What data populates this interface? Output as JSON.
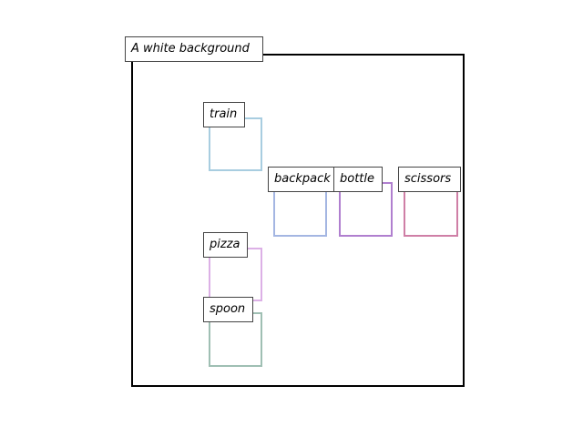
{
  "caption": "A white background",
  "objects": [
    {
      "id": "train",
      "label": "train",
      "color": "#a8cde0"
    },
    {
      "id": "backpack",
      "label": "backpack",
      "color": "#a4b6e2"
    },
    {
      "id": "bottle",
      "label": "bottle",
      "color": "#b07fcf"
    },
    {
      "id": "scissors",
      "label": "scissors",
      "color": "#cf7fa6"
    },
    {
      "id": "pizza",
      "label": "pizza",
      "color": "#dcb0e6"
    },
    {
      "id": "spoon",
      "label": "spoon",
      "color": "#9fbfb3"
    }
  ]
}
